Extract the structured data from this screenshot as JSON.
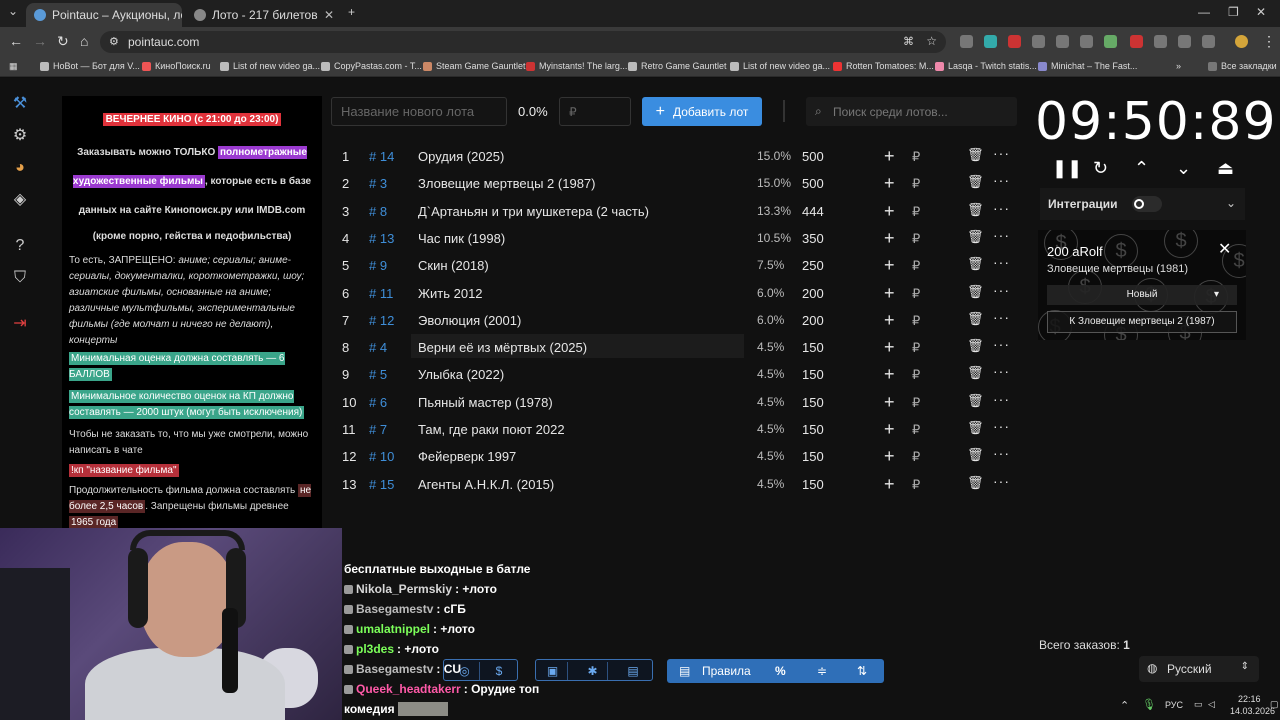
{
  "browser": {
    "tabs": [
      {
        "title": "Pointauc – Аукционы, лотере",
        "active": true
      },
      {
        "title": "Лото - 217 билетов",
        "active": false
      }
    ],
    "url": "pointauc.com",
    "bookmarks": [
      "HoBot — Бот для V...",
      "КиноПоиск.ru",
      "List of new video ga...",
      "CopyPastas.com - T...",
      "Steam Game Gauntlet",
      "Myinstants! The larg...",
      "Retro Game Gauntlet",
      "List of new video ga...",
      "Rotten Tomatoes: M...",
      "Lasqa - Twitch statis...",
      "Minichat – The Fast...",
      "Все закладки"
    ]
  },
  "rules": {
    "title": "ВЕЧЕРНЕЕ КИНО (с 21:00 до 23:00)",
    "p1_a": "Заказывать можно ТОЛЬКО ",
    "p1_hl": "полнометражные художественные фильмы",
    "p1_b": ", которые есть в базе данных на сайте Кинопоиск.ру или IMDB.com",
    "p2": "(кроме порно, гейства и педофильства)",
    "p3_a": "То есть, ЗАПРЕЩЕНО: ",
    "p3_b": "аниме; сериалы; аниме-сериалы, документалки, короткометражки, шоу; азиатские фильмы, основанные на аниме; различные мультфильмы, экспериментальные фильмы (где молчат и ничего не делают), концерты",
    "p4": "Минимальная оценка должна составлять — 6 БАЛЛОВ",
    "p5": "Минимальное количество оценок на КП должно составлять — 2000 штук (могут быть исключения)",
    "p6": "Чтобы не заказать то, что мы уже смотрели, можно написать в чате",
    "p7": "!кп \"название фильма\"",
    "p8_a": "Продолжительность фильма должна составлять ",
    "p8_hl1": "не более 2,5 часов",
    "p8_b": ". Запрещены фильмы древнее ",
    "p8_hl2": "1965 года"
  },
  "controls": {
    "new_lot_placeholder": "Название нового лота",
    "percent": "0.0%",
    "rub_placeholder": "₽",
    "add_label": "Добавить лот",
    "search_placeholder": "Поиск среди лотов..."
  },
  "lots": [
    {
      "idx": "1",
      "tag": "# 14",
      "name": "Орудия (2025)",
      "pct": "15.0%",
      "amount": "500"
    },
    {
      "idx": "2",
      "tag": "# 3",
      "name": "Зловещие мертвецы 2 (1987)",
      "pct": "15.0%",
      "amount": "500"
    },
    {
      "idx": "3",
      "tag": "# 8",
      "name": "Д`Артаньян и три мушкетера (2 часть)",
      "pct": "13.3%",
      "amount": "444"
    },
    {
      "idx": "4",
      "tag": "# 13",
      "name": "Час пик (1998)",
      "pct": "10.5%",
      "amount": "350"
    },
    {
      "idx": "5",
      "tag": "# 9",
      "name": "Скин (2018)",
      "pct": "7.5%",
      "amount": "250"
    },
    {
      "idx": "6",
      "tag": "# 11",
      "name": "Жить 2012",
      "pct": "6.0%",
      "amount": "200"
    },
    {
      "idx": "7",
      "tag": "# 12",
      "name": "Эволюция (2001)",
      "pct": "6.0%",
      "amount": "200"
    },
    {
      "idx": "8",
      "tag": "# 4",
      "name": "Верни её из мёртвых (2025)",
      "pct": "4.5%",
      "amount": "150"
    },
    {
      "idx": "9",
      "tag": "# 5",
      "name": "Улыбка (2022)",
      "pct": "4.5%",
      "amount": "150"
    },
    {
      "idx": "10",
      "tag": "# 6",
      "name": "Пьяный мастер (1978)",
      "pct": "4.5%",
      "amount": "150"
    },
    {
      "idx": "11",
      "tag": "# 7",
      "name": "Там, где раки поют 2022",
      "pct": "4.5%",
      "amount": "150"
    },
    {
      "idx": "12",
      "tag": "# 10",
      "name": "Фейерверк 1997",
      "pct": "4.5%",
      "amount": "150"
    },
    {
      "idx": "13",
      "tag": "# 15",
      "name": "Агенты А.Н.К.Л. (2015)",
      "pct": "4.5%",
      "amount": "150"
    }
  ],
  "timer": "09:50:89",
  "integrations_label": "Интеграции",
  "card": {
    "title": "200 aRolf",
    "subtitle": "Зловещие мертвецы (1981)",
    "select": "Новый",
    "button": "К Зловещие мертвецы 2 (1987)"
  },
  "orders": {
    "label": "Всего заказов:",
    "count": "1"
  },
  "language": "Русский",
  "rules_button": "Правила",
  "chat": [
    {
      "user": "",
      "text": "бесплатные выходные в батле",
      "color": "#ffffff"
    },
    {
      "user": "Nikola_Permskiy",
      "text": "+лото",
      "color": "#d8d8d8"
    },
    {
      "user": "Basegamestv",
      "text": "сГБ",
      "color": "#bbbbbb"
    },
    {
      "user": "umalatnippel",
      "text": "+лото",
      "color": "#7cff5a"
    },
    {
      "user": "pl3des",
      "text": "+лото",
      "color": "#7cff5a"
    },
    {
      "user": "Basegamestv",
      "text": "CU",
      "color": "#bbbbbb"
    },
    {
      "user": "Queek_headtakerr",
      "text": "Орудие топ",
      "color": "#ff5aa8"
    },
    {
      "user": "",
      "text": "комедия",
      "color": "#ffffff"
    }
  ],
  "tray": {
    "lang": "РУС",
    "time": "22:16",
    "date": "14.03.2026"
  },
  "colors": {
    "accent": "#3a8de0",
    "tag": "#3f8ed8"
  }
}
